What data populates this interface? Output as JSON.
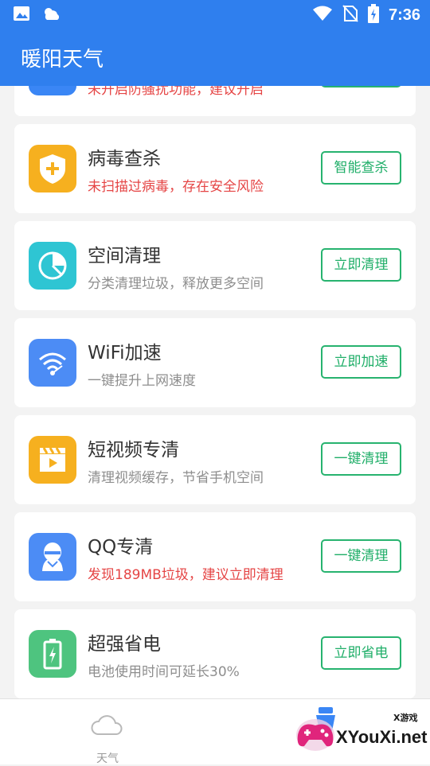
{
  "status_bar": {
    "time": "7:36",
    "left_icons": [
      "image-icon",
      "weather-icon"
    ],
    "right_icons": [
      "wifi-icon",
      "no-sim-icon",
      "battery-charging-icon"
    ]
  },
  "app_bar": {
    "title": "暖阳天气"
  },
  "cards": [
    {
      "name": "",
      "desc": "未开启防骚扰功能，建议开启",
      "desc_warn": true,
      "button": "",
      "icon": "shield-icon",
      "icon_color": "#3a86f5"
    },
    {
      "name": "病毒查杀",
      "desc": "未扫描过病毒，存在安全风险",
      "desc_warn": true,
      "button": "智能查杀",
      "icon": "shield-plus-icon",
      "icon_color": "#f6b01f"
    },
    {
      "name": "空间清理",
      "desc": "分类清理垃圾，释放更多空间",
      "desc_warn": false,
      "button": "立即清理",
      "icon": "pie-chart-icon",
      "icon_color": "#2ec5d3"
    },
    {
      "name": "WiFi加速",
      "desc": "一键提升上网速度",
      "desc_warn": false,
      "button": "立即加速",
      "icon": "wifi-speed-icon",
      "icon_color": "#4c8cf5"
    },
    {
      "name": "短视频专清",
      "desc": "清理视频缓存，节省手机空间",
      "desc_warn": false,
      "button": "一键清理",
      "icon": "video-clapper-icon",
      "icon_color": "#f6b01f"
    },
    {
      "name": "QQ专清",
      "desc": "发现189MB垃圾，建议立即清理",
      "desc_warn": true,
      "button": "一键清理",
      "icon": "qq-penguin-icon",
      "icon_color": "#4c8cf5"
    },
    {
      "name": "超强省电",
      "desc": "电池使用时间可延长30%",
      "desc_warn": false,
      "button": "立即省电",
      "icon": "battery-icon",
      "icon_color": "#4ec47f"
    }
  ],
  "bottom_nav": {
    "weather_label": "天气",
    "weather_icon": "cloud-icon",
    "right_icon": "clean-icon"
  },
  "watermark": {
    "text": "XYouXi.net",
    "sub": "X游戏"
  },
  "colors": {
    "primary": "#2f7fee",
    "button_green": "#27b36f",
    "warn_red": "#e54545"
  }
}
